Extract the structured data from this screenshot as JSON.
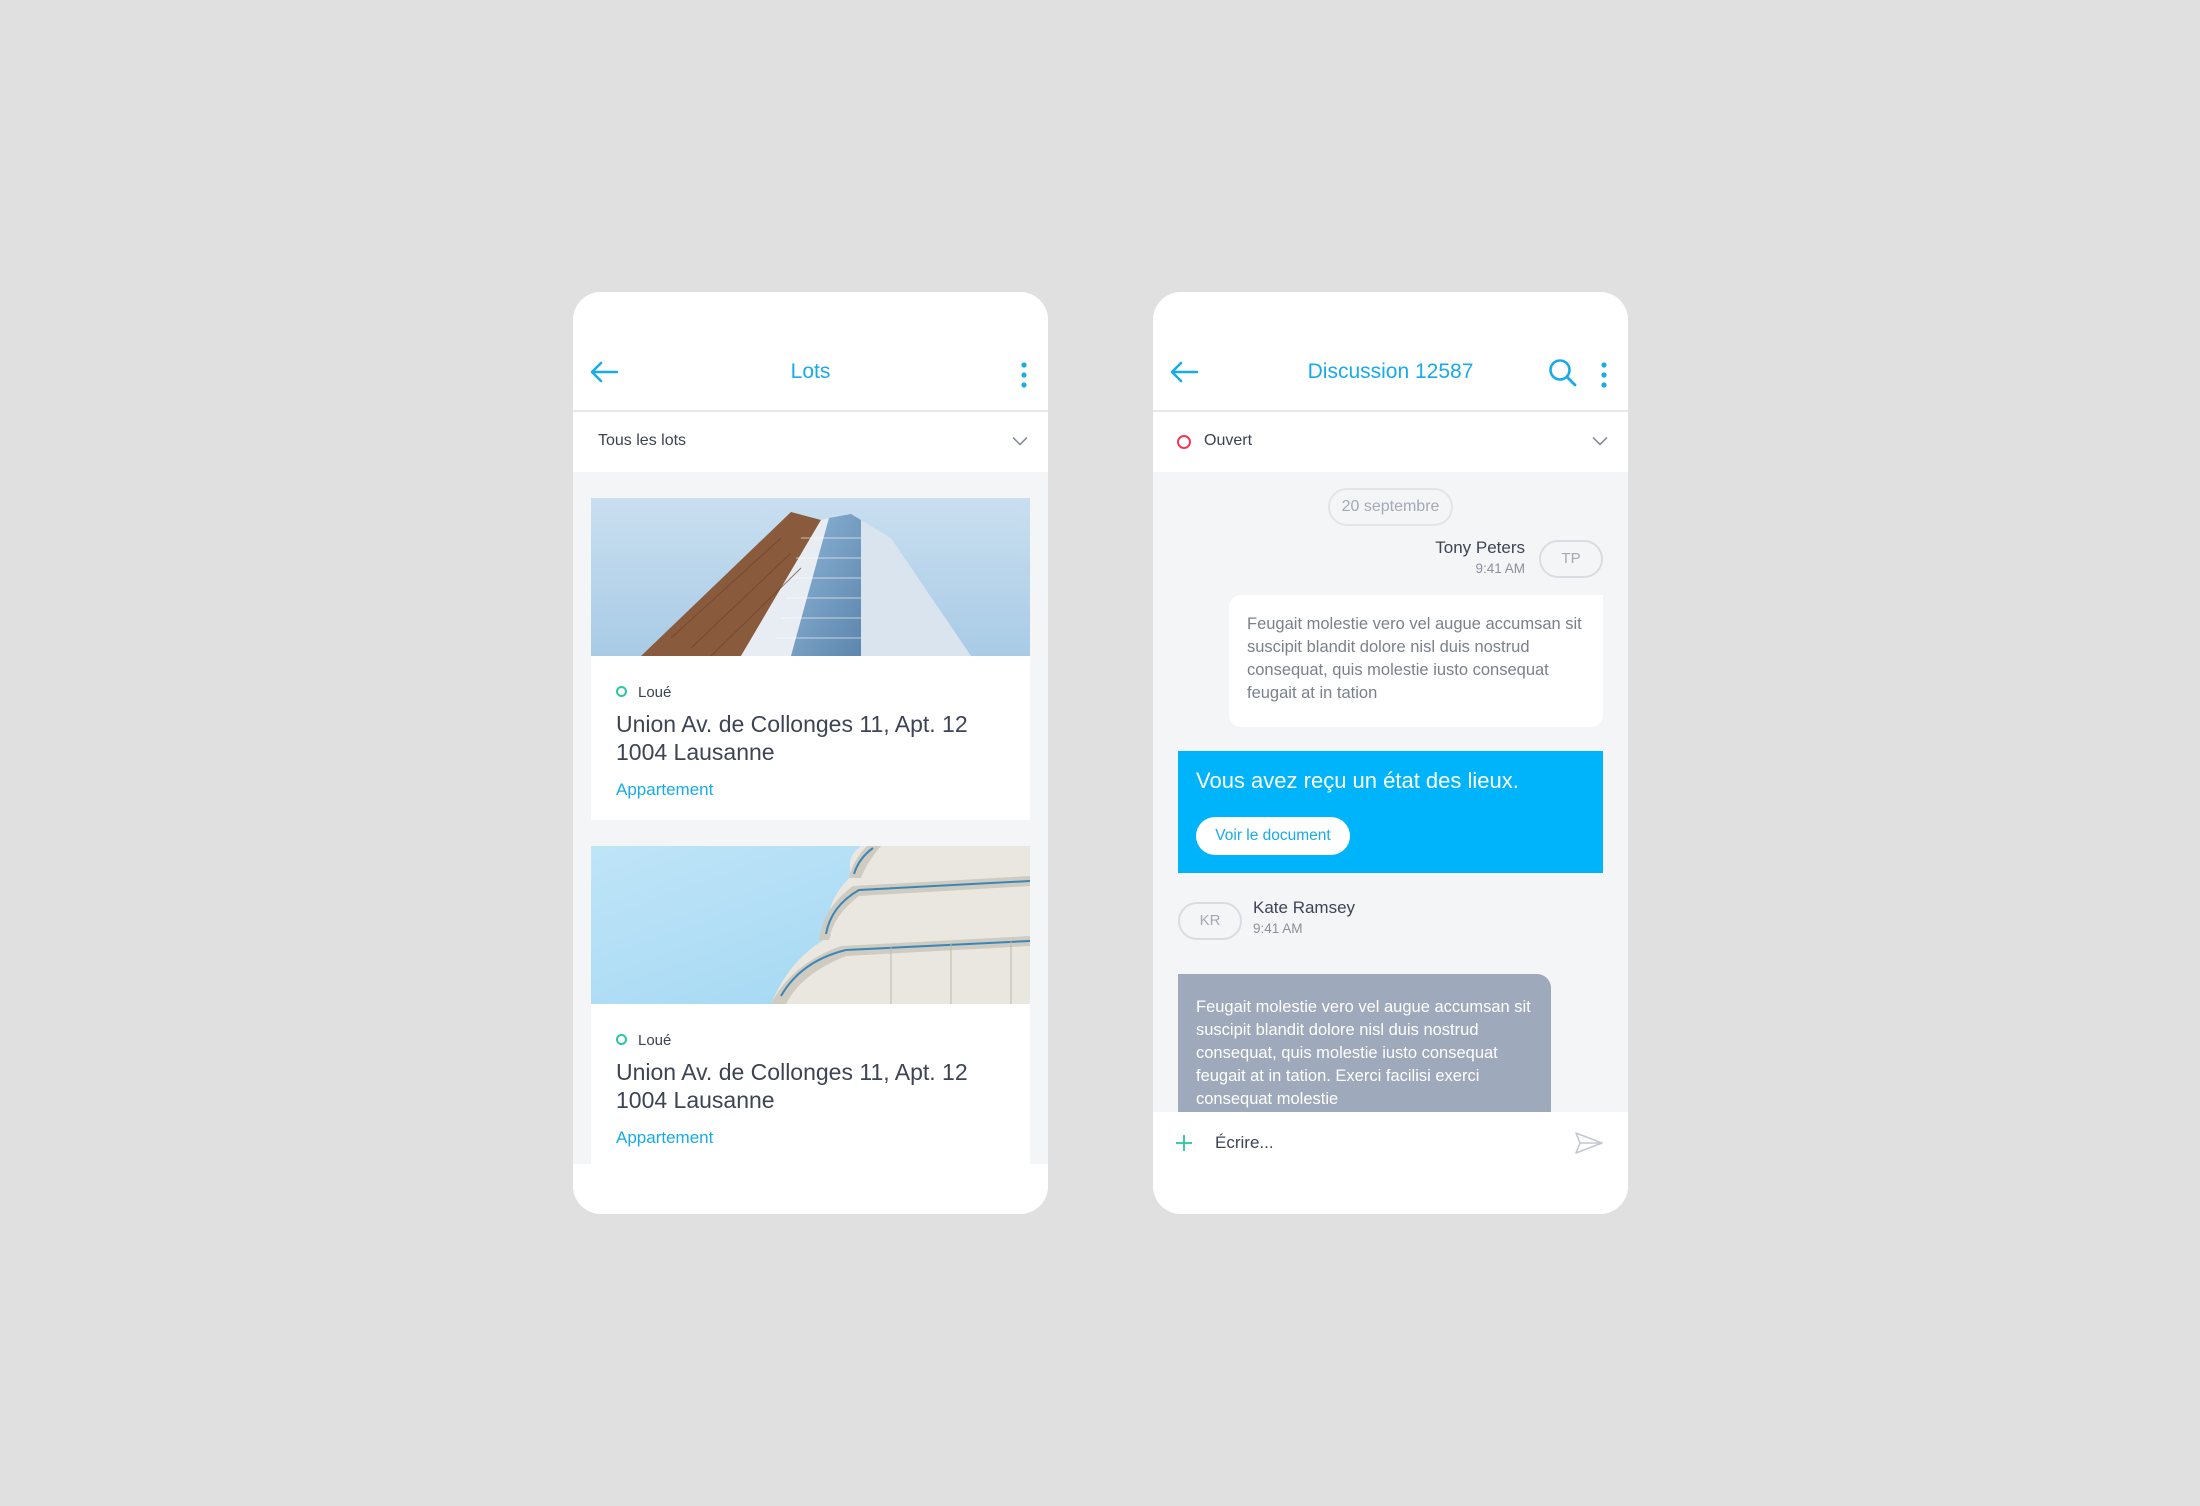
{
  "colors": {
    "background": "#e0e0e0",
    "accent": "#17abe8",
    "card_accent": "#00b4fb",
    "status_open": "#ef3c55",
    "status_rented": "#2bc7a0",
    "incoming_bubble": "#9ea9bb"
  },
  "lots_screen": {
    "title": "Lots",
    "back_icon": "arrow-left-icon",
    "menu_icon": "more-vertical-icon",
    "filter": {
      "label": "Tous les lots",
      "chevron_icon": "chevron-down-icon"
    },
    "cards": [
      {
        "image": "building-tower-photo",
        "status": "Loué",
        "address_line1": "Union Av. de Collonges 11, Apt. 12",
        "address_line2": "1004 Lausanne",
        "type": "Appartement"
      },
      {
        "image": "building-balconies-photo",
        "status": "Loué",
        "address_line1": "Union Av. de Collonges 11, Apt. 12",
        "address_line2": "1004 Lausanne",
        "type": "Appartement"
      }
    ]
  },
  "chat_screen": {
    "title": "Discussion 12587",
    "back_icon": "arrow-left-icon",
    "search_icon": "search-icon",
    "menu_icon": "more-vertical-icon",
    "status": {
      "label": "Ouvert",
      "chevron_icon": "chevron-down-icon"
    },
    "date_separator": "20 septembre",
    "messages": [
      {
        "sender": "Tony Peters",
        "initials": "TP",
        "time": "9:41 AM",
        "text": "Feugait molestie vero vel augue accumsan sit suscipit blandit dolore nisl duis nostrud consequat, quis molestie iusto consequat feugait at in tation"
      },
      {
        "sender": "Kate Ramsey",
        "initials": "KR",
        "time": "9:41 AM",
        "text": "Feugait molestie vero vel augue accumsan sit suscipit blandit dolore nisl duis nostrud consequat, quis molestie iusto consequat feugait at in tation. Exerci facilisi exerci consequat molestie"
      }
    ],
    "document_card": {
      "text": "Vous avez reçu un état des lieux.",
      "button": "Voir le document"
    },
    "composer": {
      "placeholder": "Écrire...",
      "plus_icon": "plus-icon",
      "send_icon": "send-icon"
    }
  }
}
